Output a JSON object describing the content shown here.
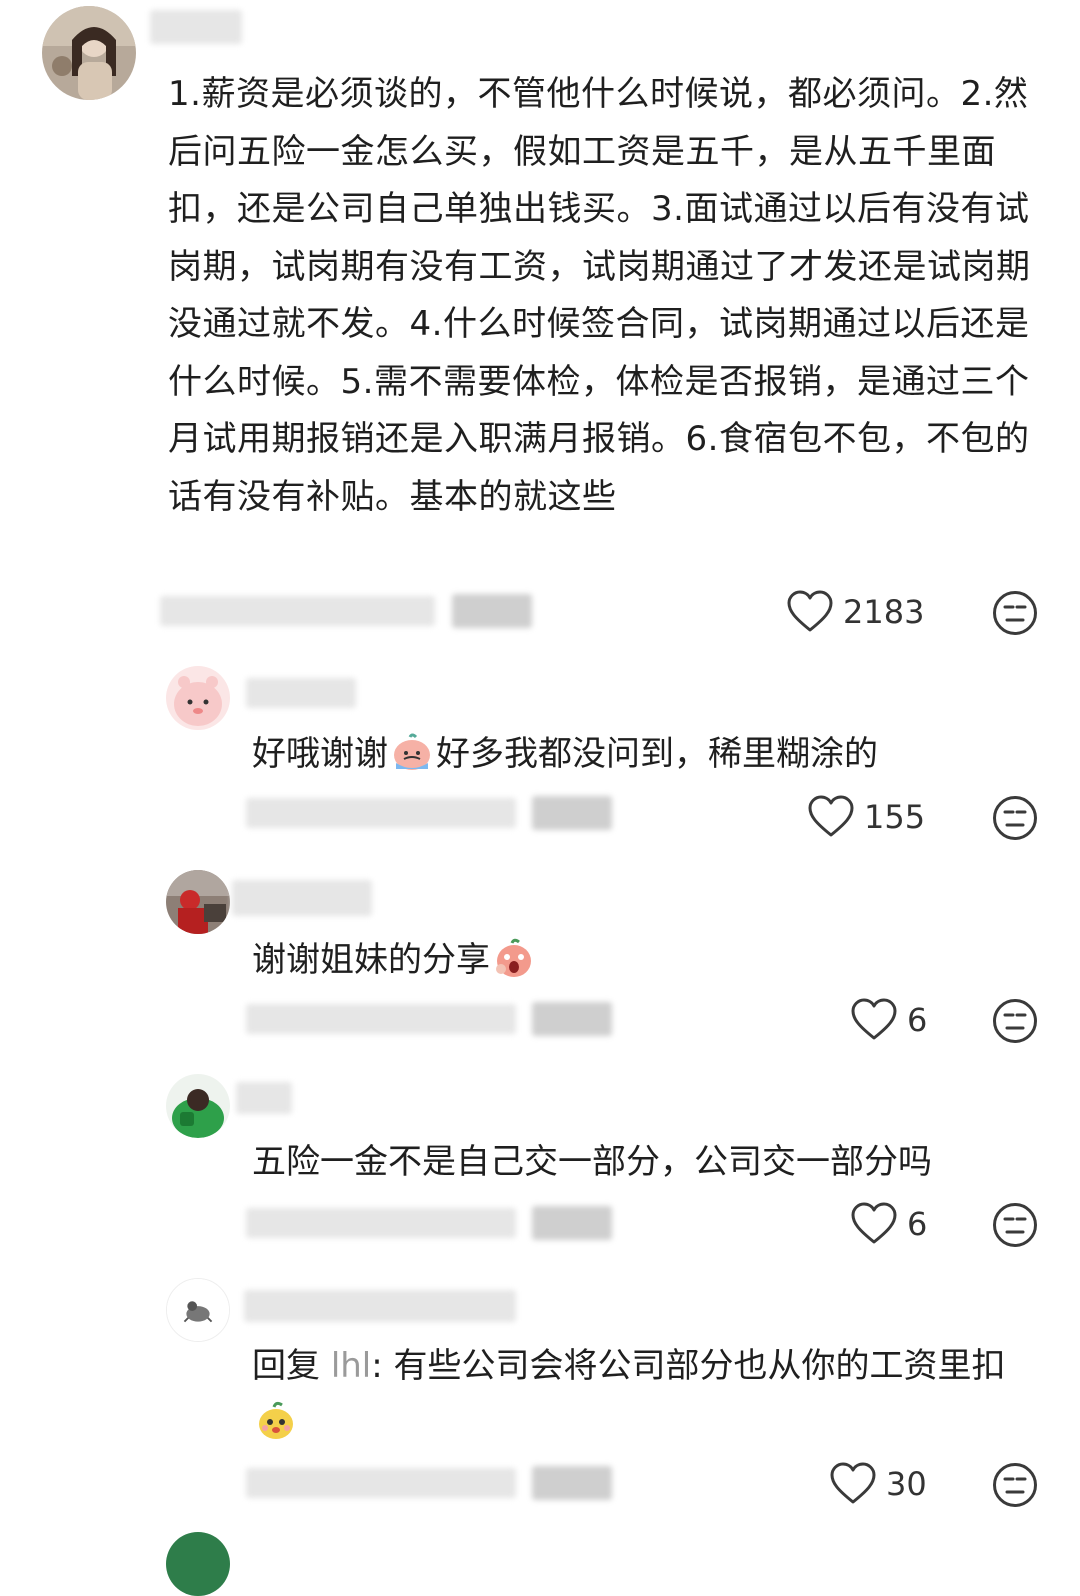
{
  "comments": [
    {
      "text": "1.薪资是必须谈的，不管他什么时候说，都必须问。2.然后问五险一金怎么买，假如工资是五千，是从五千里面扣，还是公司自己单独出钱买。3.面试通过以后有没有试岗期，试岗期有没有工资，试岗期通过了才发还是试岗期没通过就不发。4.什么时候签合同，试岗期通过以后还是什么时候。5.需不需要体检，体检是否报销，是通过三个月试用期报销还是入职满月报销。6.食宿包不包，不包的话有没有补贴。基本的就这些",
      "likes": "2183"
    },
    {
      "text_before": "好哦谢谢",
      "text_after": "好多我都没问到，稀里糊涂的",
      "emoji": "crying-peach-emoji",
      "likes": "155"
    },
    {
      "text_before": "谢谢姐妹的分享",
      "emoji": "shocked-peach-emoji",
      "likes": "6"
    },
    {
      "text_before": "五险一金不是自己交一部分，公司交一部分吗",
      "likes": "6"
    },
    {
      "reply_prefix": "回复 ",
      "reply_to": "lhl",
      "text_before": ": 有些公司会将公司部分也从你的工资里扣",
      "emoji": "smiling-sprout-emoji",
      "likes": "30"
    }
  ],
  "icons": {
    "like": "heart-outline-icon",
    "reaction": "neutral-face-icon"
  }
}
